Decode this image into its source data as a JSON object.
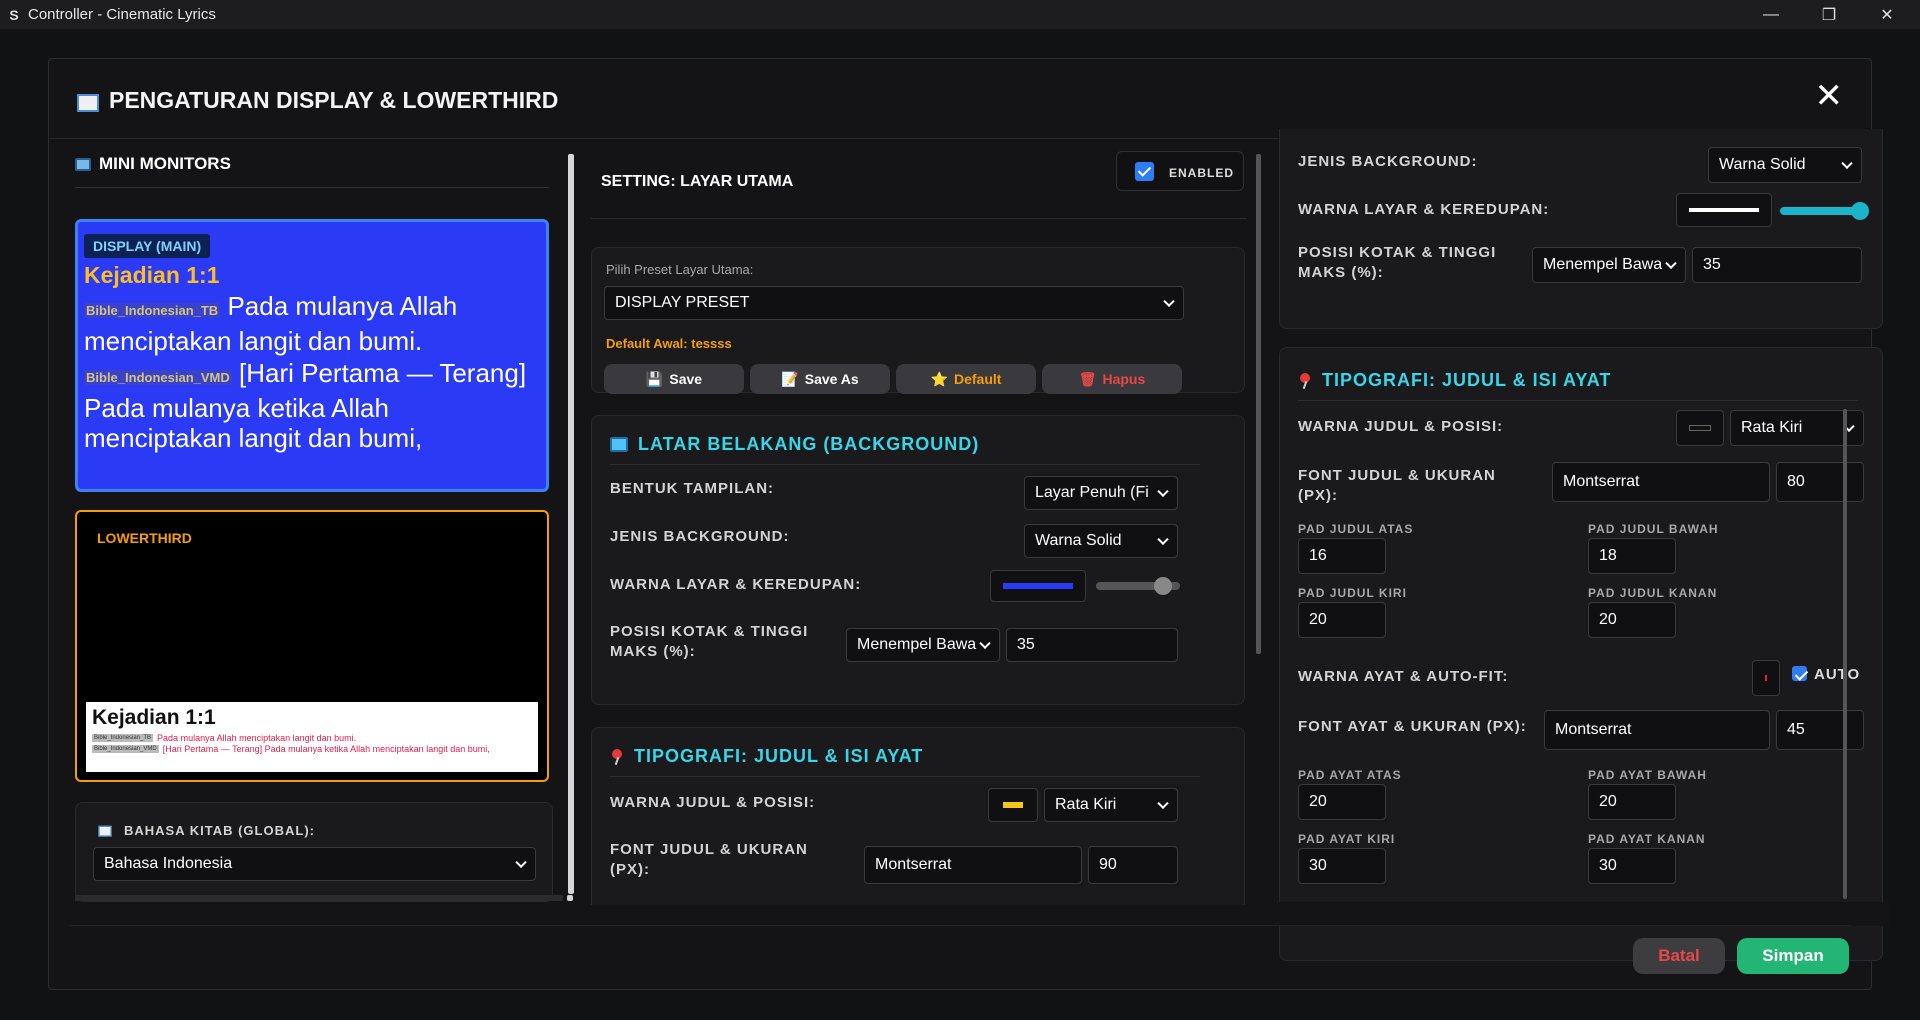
{
  "window": {
    "title": "Controller - Cinematic Lyrics"
  },
  "modal": {
    "title": "PENGATURAN DISPLAY & LOWERTHIRD"
  },
  "left": {
    "title": "MINI MONITORS",
    "display_tag": "DISPLAY (MAIN)",
    "display_ref": "Kejadian 1:1",
    "display_ver1": "Bible_Indonesian_TB",
    "display_text1": "Pada mulanya Allah menciptakan langit dan bumi.",
    "display_ver2": "Bible_Indonesian_VMD",
    "display_text2": "[Hari Pertama — Terang] Pada mulanya ketika Allah menciptakan langit dan bumi,",
    "lt_tag": "LOWERTHIRD",
    "lt_ref": "Kejadian 1:1",
    "lt_ver1": "Bible_Indonesian_TB",
    "lt_text1": "Pada mulanya Allah menciptakan langit dan bumi.",
    "lt_ver2": "Bible_Indonesian_VMD",
    "lt_text2": "[Hari Pertama — Terang] Pada mulanya ketika Allah menciptakan langit dan bumi,",
    "bahasa_label": "BAHASA KITAB (GLOBAL):",
    "bahasa_value": "Bahasa Indonesia"
  },
  "middle": {
    "title": "SETTING: LAYAR UTAMA",
    "enabled_label": "ENABLED",
    "preset_label": "Pilih Preset Layar Utama:",
    "preset_value": "DISPLAY PRESET",
    "default_note": "Default Awal: tessss",
    "btn_save": "Save",
    "btn_saveas": "Save As",
    "btn_default": "Default",
    "btn_hapus": "Hapus",
    "bg_title": "LATAR BELAKANG (BACKGROUND)",
    "bentuk_label": "BENTUK TAMPILAN:",
    "bentuk_value": "Layar Penuh (Fi",
    "jenis_label": "JENIS BACKGROUND:",
    "jenis_value": "Warna Solid",
    "warna_label": "WARNA LAYAR & KEREDUPAN:",
    "posisi_label": "POSISI KOTAK & TINGGI MAKS (%):",
    "posisi_value": "Menempel Bawa",
    "posisi_height": "35",
    "typo_title": "TIPOGRAFI: JUDUL & ISI AYAT",
    "wj_label": "WARNA JUDUL & POSISI:",
    "wj_align": "Rata Kiri",
    "fj_label": "FONT JUDUL & UKURAN (PX):",
    "fj_font": "Montserrat",
    "fj_size": "90",
    "swatch_bg": "#2b3af5",
    "swatch_title": "#f5c518",
    "dim_level": 0.8
  },
  "right": {
    "jenis_label": "JENIS BACKGROUND:",
    "jenis_value": "Warna Solid",
    "warna_label": "WARNA LAYAR & KEREDUPAN:",
    "posisi_label": "POSISI KOTAK & TINGGI MAKS (%):",
    "posisi_value": "Menempel Bawa",
    "posisi_height": "35",
    "typo_title": "TIPOGRAFI: JUDUL & ISI AYAT",
    "wj_label": "WARNA JUDUL & POSISI:",
    "wj_align": "Rata Kiri",
    "fj_label": "FONT JUDUL & UKURAN (PX):",
    "fj_font": "Montserrat",
    "fj_size": "80",
    "pad_judul_atas_label": "PAD JUDUL ATAS",
    "pad_judul_atas": "16",
    "pad_judul_bawah_label": "PAD JUDUL BAWAH",
    "pad_judul_bawah": "18",
    "pad_judul_kiri_label": "PAD JUDUL KIRI",
    "pad_judul_kiri": "20",
    "pad_judul_kanan_label": "PAD JUDUL KANAN",
    "pad_judul_kanan": "20",
    "wa_label": "WARNA AYAT & AUTO-FIT:",
    "auto_label": "AUTO",
    "fa_label": "FONT AYAT & UKURAN (PX):",
    "fa_font": "Montserrat",
    "fa_size": "45",
    "pad_ayat_atas_label": "PAD AYAT ATAS",
    "pad_ayat_atas": "20",
    "pad_ayat_bawah_label": "PAD AYAT BAWAH",
    "pad_ayat_bawah": "20",
    "pad_ayat_kiri_label": "PAD AYAT KIRI",
    "pad_ayat_kiri": "30",
    "pad_ayat_kanan_label": "PAD AYAT KANAN",
    "pad_ayat_kanan": "30",
    "swatch_bg": "#ffffff",
    "swatch_title": "#111111",
    "dim_level": 0.95
  },
  "footer": {
    "batal": "Batal",
    "simpan": "Simpan"
  }
}
